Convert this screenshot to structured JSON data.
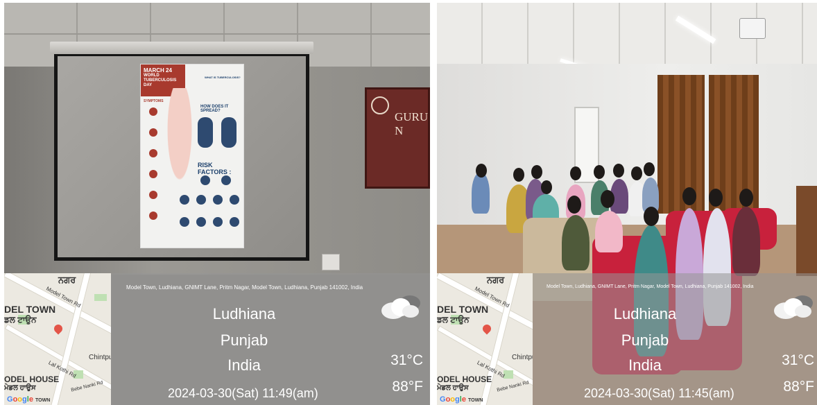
{
  "photos": [
    {
      "scene": "projection",
      "poster": {
        "date_line": "MARCH 24",
        "event_line1": "WORLD",
        "event_line2": "TUBERCULOSIS",
        "event_line3": "DAY",
        "q1": "WHAT IS TUBERCULOSIS?",
        "q2": "HOW DOES IT SPREAD?",
        "q3": "RISK FACTORS :",
        "symptoms": "SYMPTOMS"
      },
      "banner_text": "GURU N",
      "overlay": {
        "address": "Model Town, Ludhiana, GNIMT Lane, Pritm Nagar, Model Town, Ludhiana, Punjab 141002, India",
        "city": "Ludhiana",
        "state": "Punjab",
        "country": "India",
        "datetime": "2024-03-30(Sat)   11:49(am)",
        "temp_c": "31°C",
        "temp_f": "88°F",
        "weather_icon": "cloud-icon",
        "map": {
          "label_top": "ਨਗਰ",
          "label_area": "DEL TOWN",
          "label_area_pa": "ਡਲ ਟਾਉਨ",
          "road1": "Model Town Rd",
          "road2": "Lal Kothi Rd",
          "road3": "Bebe Nanki Rd",
          "label_right": "Chintpu",
          "label_bottom": "ODEL HOUSE",
          "label_bottom_pa": "ਮੇਡਲ ਹਾਉਸ",
          "brand": "Google",
          "brand_sub": "TOWN"
        }
      }
    },
    {
      "scene": "audience",
      "overlay": {
        "address": "Model Town, Ludhiana, GNIMT Lane, Pritm Nagar, Model Town, Ludhiana, Punjab 141002, India",
        "city": "Ludhiana",
        "state": "Punjab",
        "country": "India",
        "datetime": "2024-03-30(Sat)   11:45(am)",
        "temp_c": "31°C",
        "temp_f": "88°F",
        "weather_icon": "cloud-icon",
        "map": {
          "label_top": "ਨਗਰ",
          "label_area": "DEL TOWN",
          "label_area_pa": "ਡਲ ਟਾਉਨ",
          "road1": "Model Town Rd",
          "road2": "Lal Kothi Rd",
          "road3": "Bebe Nanki Rd",
          "label_right": "Chintpu",
          "label_bottom": "ODEL HOUSE",
          "label_bottom_pa": "ਮੇਡਲ ਹਾਉਸ",
          "brand": "Google",
          "brand_sub": "TOWN"
        }
      }
    }
  ],
  "colors": {
    "poster_red": "#a83a2e",
    "poster_blue": "#1b3f6b",
    "banner": "#6b2a26",
    "sofa_red": "#c8213c",
    "sofa_beige": "#cbb99c",
    "curtain": "#7a4620"
  }
}
